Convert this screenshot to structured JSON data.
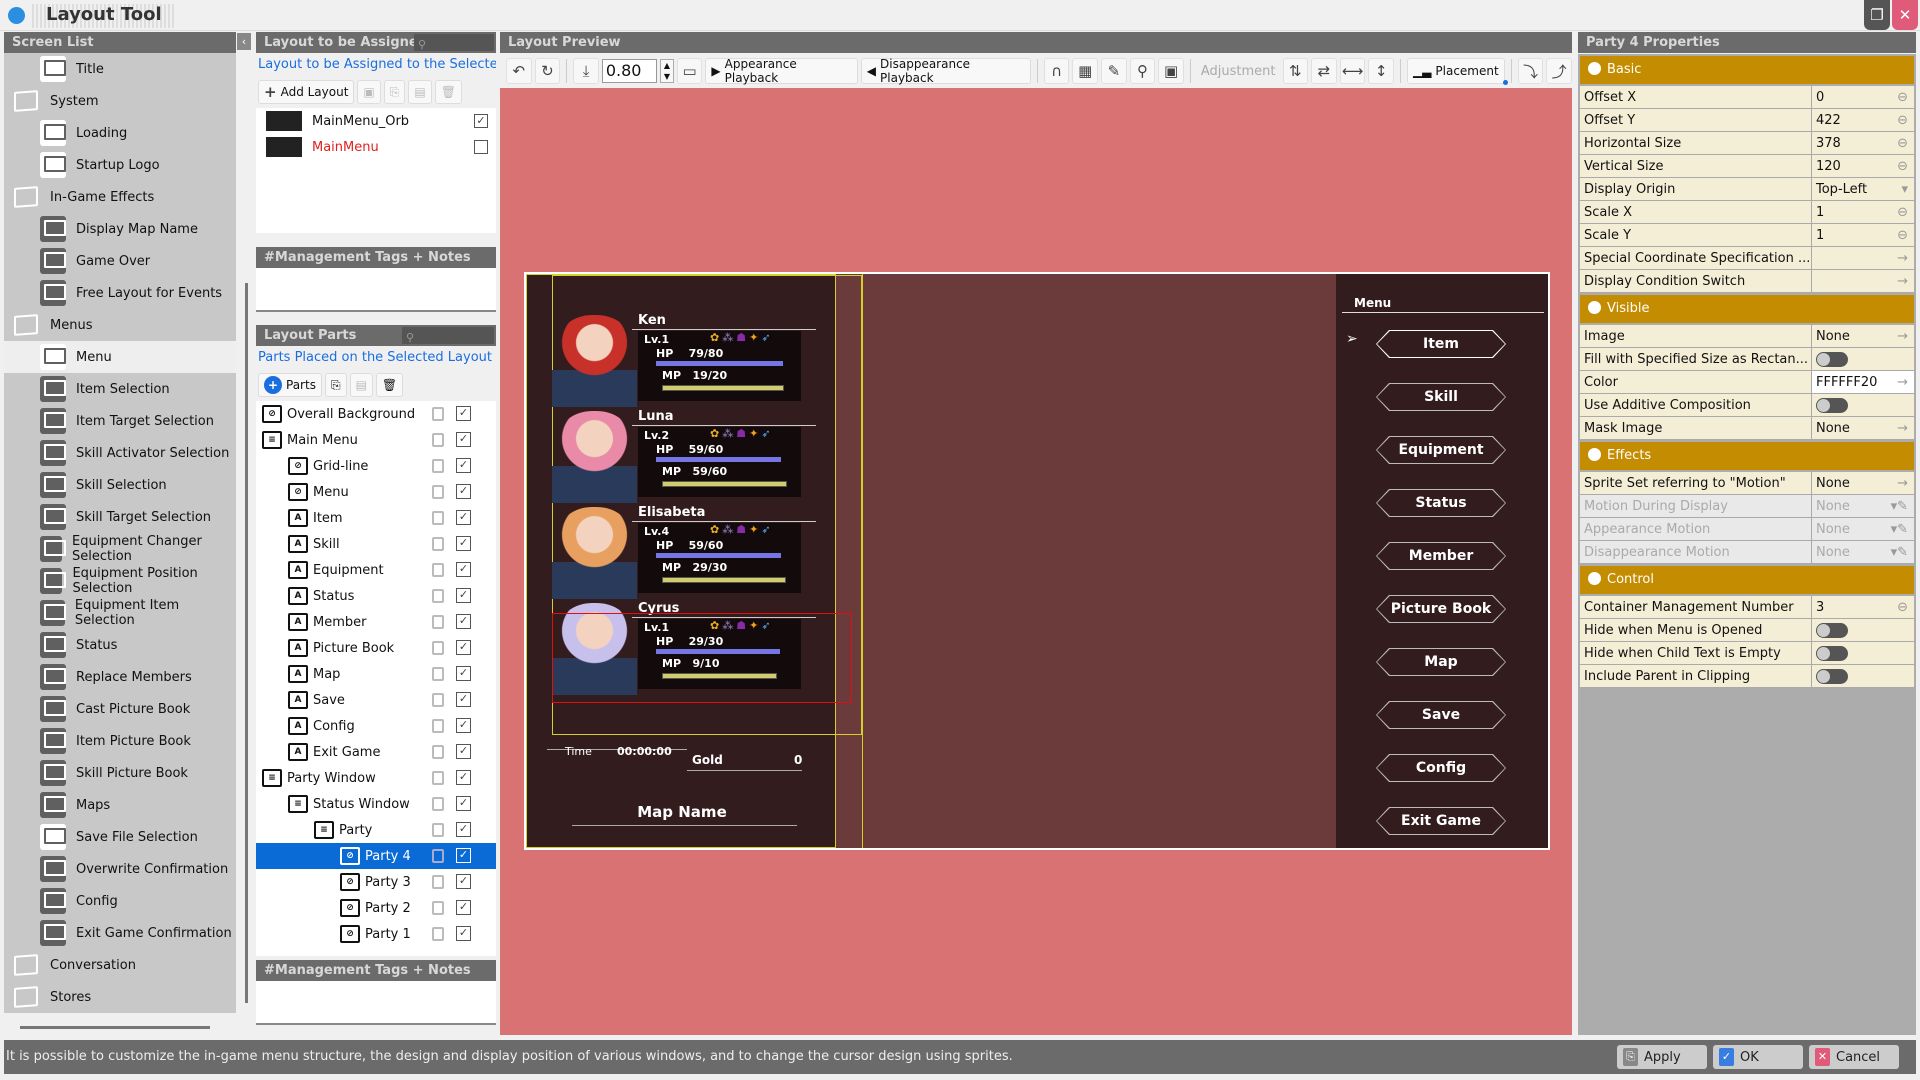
{
  "window": {
    "title": "Layout Tool",
    "restore_icon": "restore-icon",
    "close_icon": "close-icon"
  },
  "screen_list": {
    "header": "Screen List",
    "items": [
      {
        "label": "Title",
        "type": "screen",
        "level": 0
      },
      {
        "label": "System",
        "type": "folder",
        "level": 0
      },
      {
        "label": "Loading",
        "type": "screen",
        "level": 1
      },
      {
        "label": "Startup Logo",
        "type": "screen",
        "level": 1
      },
      {
        "label": "In-Game Effects",
        "type": "folder",
        "level": 0
      },
      {
        "label": "Display Map Name",
        "type": "screen",
        "level": 1
      },
      {
        "label": "Game Over",
        "type": "screen",
        "level": 1
      },
      {
        "label": "Free Layout for Events",
        "type": "screen",
        "level": 1
      },
      {
        "label": "Menus",
        "type": "folder",
        "level": 0
      },
      {
        "label": "Menu",
        "type": "screen",
        "level": 1,
        "selected": true
      },
      {
        "label": "Item Selection",
        "type": "screen",
        "level": 1
      },
      {
        "label": "Item Target Selection",
        "type": "screen",
        "level": 1
      },
      {
        "label": "Skill Activator Selection",
        "type": "screen",
        "level": 1
      },
      {
        "label": "Skill Selection",
        "type": "screen",
        "level": 1
      },
      {
        "label": "Skill Target Selection",
        "type": "screen",
        "level": 1
      },
      {
        "label": "Equipment Changer Selection",
        "type": "screen",
        "level": 1
      },
      {
        "label": "Equipment Position Selection",
        "type": "screen",
        "level": 1
      },
      {
        "label": "Equipment Item Selection",
        "type": "screen",
        "level": 1
      },
      {
        "label": "Status",
        "type": "screen",
        "level": 1
      },
      {
        "label": "Replace Members",
        "type": "screen",
        "level": 1
      },
      {
        "label": "Cast Picture Book",
        "type": "screen",
        "level": 1
      },
      {
        "label": "Item Picture Book",
        "type": "screen",
        "level": 1
      },
      {
        "label": "Skill Picture Book",
        "type": "screen",
        "level": 1
      },
      {
        "label": "Maps",
        "type": "screen",
        "level": 1
      },
      {
        "label": "Save File Selection",
        "type": "screen",
        "level": 1
      },
      {
        "label": "Overwrite Confirmation",
        "type": "screen",
        "level": 1
      },
      {
        "label": "Config",
        "type": "screen",
        "level": 1
      },
      {
        "label": "Exit Game Confirmation",
        "type": "screen",
        "level": 1
      },
      {
        "label": "Conversation",
        "type": "folder",
        "level": 0
      },
      {
        "label": "Stores",
        "type": "folder",
        "level": 0
      }
    ]
  },
  "layout_assign": {
    "header": "Layout to be Assigned",
    "description": "Layout to be Assigned to the Selected Screen",
    "add_label": "Add Layout",
    "layouts": [
      {
        "name": "MainMenu_Orb",
        "checked": true,
        "color": "#111111"
      },
      {
        "name": "MainMenu",
        "checked": false,
        "color": "#e02020"
      }
    ],
    "notes_header": "#Management Tags + Notes"
  },
  "layout_parts": {
    "header": "Layout Parts",
    "description": "Parts Placed on the Selected Layout",
    "add_label": "Parts",
    "items": [
      {
        "label": "Overall Background",
        "level": 0,
        "icon": "link"
      },
      {
        "label": "Main Menu",
        "level": 0,
        "icon": "folder-open"
      },
      {
        "label": "Grid-line",
        "level": 1,
        "icon": "link"
      },
      {
        "label": "Menu",
        "level": 1,
        "icon": "link"
      },
      {
        "label": "Item",
        "level": 1,
        "icon": "text"
      },
      {
        "label": "Skill",
        "level": 1,
        "icon": "text"
      },
      {
        "label": "Equipment",
        "level": 1,
        "icon": "text"
      },
      {
        "label": "Status",
        "level": 1,
        "icon": "text"
      },
      {
        "label": "Member",
        "level": 1,
        "icon": "text"
      },
      {
        "label": "Picture Book",
        "level": 1,
        "icon": "text"
      },
      {
        "label": "Map",
        "level": 1,
        "icon": "text"
      },
      {
        "label": "Save",
        "level": 1,
        "icon": "text"
      },
      {
        "label": "Config",
        "level": 1,
        "icon": "text"
      },
      {
        "label": "Exit Game",
        "level": 1,
        "icon": "text"
      },
      {
        "label": "Party Window",
        "level": 0,
        "icon": "folder-open"
      },
      {
        "label": "Status Window",
        "level": 1,
        "icon": "folder-open"
      },
      {
        "label": "Party",
        "level": 2,
        "icon": "folder-open"
      },
      {
        "label": "Party 4",
        "level": 3,
        "icon": "link",
        "selected": true
      },
      {
        "label": "Party 3",
        "level": 3,
        "icon": "link"
      },
      {
        "label": "Party 2",
        "level": 3,
        "icon": "link"
      },
      {
        "label": "Party 1",
        "level": 3,
        "icon": "link"
      }
    ],
    "notes_header": "#Management Tags + Notes"
  },
  "preview": {
    "header": "Layout Preview",
    "zoom": "0.80",
    "appearance_label": "Appearance Playback",
    "disappearance_label": "Disappearance Playback",
    "adjustment_label": "Adjustment",
    "placement_label": "Placement",
    "game": {
      "party": [
        {
          "name": "Ken",
          "level": "Lv.1",
          "hp": "79/80",
          "mp": "19/20",
          "hp_frac": 0.99,
          "mp_frac": 0.95,
          "hair": "#c8302a"
        },
        {
          "name": "Luna",
          "level": "Lv.2",
          "hp": "59/60",
          "mp": "59/60",
          "hp_frac": 0.98,
          "mp_frac": 0.98,
          "hair": "#e88aa8"
        },
        {
          "name": "Elisabeta",
          "level": "Lv.4",
          "hp": "59/60",
          "mp": "29/30",
          "hp_frac": 0.98,
          "mp_frac": 0.97,
          "hair": "#e8a060"
        },
        {
          "name": "Cyrus",
          "level": "Lv.1",
          "hp": "29/30",
          "mp": "9/10",
          "hp_frac": 0.97,
          "mp_frac": 0.9,
          "hair": "#c8c0ec"
        }
      ],
      "hp_label": "HP",
      "mp_label": "MP",
      "time_label": "Time",
      "time_value": "00:00:00",
      "gold_label": "Gold",
      "gold_value": "0",
      "map_name": "Map Name",
      "menu_title": "Menu",
      "menu_items": [
        "Item",
        "Skill",
        "Equipment",
        "Status",
        "Member",
        "Picture Book",
        "Map",
        "Save",
        "Config",
        "Exit Game"
      ]
    }
  },
  "properties": {
    "header": "Party 4 Properties",
    "sections": [
      {
        "title": "Basic",
        "rows": [
          {
            "key": "Offset X",
            "value": "0",
            "action": "spin"
          },
          {
            "key": "Offset Y",
            "value": "422",
            "action": "spin"
          },
          {
            "key": "Horizontal Size",
            "value": "378",
            "action": "spin"
          },
          {
            "key": "Vertical Size",
            "value": "120",
            "action": "spin"
          },
          {
            "key": "Display Origin",
            "value": "Top-Left",
            "action": "dropdown"
          },
          {
            "key": "Scale X",
            "value": "1",
            "action": "spin"
          },
          {
            "key": "Scale Y",
            "value": "1",
            "action": "spin"
          },
          {
            "key": "Special Coordinate Specification ...",
            "value": "",
            "action": "arrow"
          },
          {
            "key": "Display Condition Switch",
            "value": "",
            "action": "arrow"
          }
        ]
      },
      {
        "title": "Visible",
        "rows": [
          {
            "key": "Image",
            "value": "None",
            "action": "arrow"
          },
          {
            "key": "Fill with Specified Size as Rectan...",
            "value": "",
            "action": "toggle",
            "on": false
          },
          {
            "key": "Color",
            "value": "FFFFFF20",
            "action": "arrow",
            "highlight": true
          },
          {
            "key": "Use Additive Composition",
            "value": "",
            "action": "toggle",
            "on": false
          },
          {
            "key": "Mask Image",
            "value": "None",
            "action": "arrow"
          }
        ]
      },
      {
        "title": "Effects",
        "rows": [
          {
            "key": "Sprite Set referring to \"Motion\"",
            "value": "None",
            "action": "arrow"
          },
          {
            "key": "Motion During Display",
            "value": "None",
            "action": "edit",
            "disabled": true
          },
          {
            "key": "Appearance Motion",
            "value": "None",
            "action": "edit",
            "disabled": true
          },
          {
            "key": "Disappearance Motion",
            "value": "None",
            "action": "edit",
            "disabled": true
          }
        ]
      },
      {
        "title": "Control",
        "rows": [
          {
            "key": "Container Management Number",
            "value": "3",
            "action": "spin"
          },
          {
            "key": "Hide when Menu is Opened",
            "value": "",
            "action": "toggle",
            "on": false
          },
          {
            "key": "Hide when Child Text is Empty",
            "value": "",
            "action": "toggle",
            "on": false
          },
          {
            "key": "Include Parent in Clipping",
            "value": "",
            "action": "toggle",
            "on": false
          }
        ]
      }
    ]
  },
  "statusbar": {
    "message": "It is possible to customize the in-game menu structure, the design and display position of various windows, and to change the cursor design using sprites.",
    "apply_label": "Apply",
    "ok_label": "OK",
    "cancel_label": "Cancel"
  },
  "colors": {
    "accent_section": "#c48c00",
    "preview_bg": "#d97373",
    "selection": "#0a6ad6"
  }
}
